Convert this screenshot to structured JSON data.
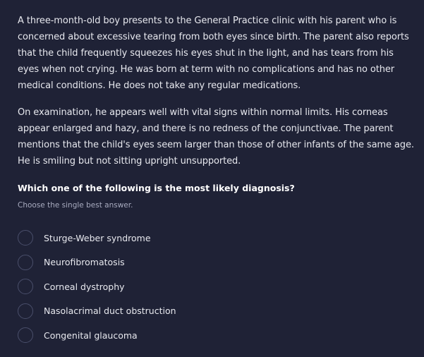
{
  "stem": {
    "paragraph_1": "A three-month-old boy presents to the General Practice clinic with his parent who is concerned about excessive tearing from both eyes since birth. The parent also reports that the child frequently squeezes his eyes shut in the light, and has tears from his eyes when not crying. He was born at term with no complications and has no other medical conditions. He does not take any regular medications.",
    "paragraph_2": "On examination, he appears well with vital signs within normal limits. His corneas appear enlarged and hazy, and there is no redness of the conjunctivae. The parent mentions that the child's eyes seem larger than those of other infants of the same age. He is smiling but not sitting upright unsupported."
  },
  "question": "Which one of the following is the most likely diagnosis?",
  "instruction": "Choose the single best answer.",
  "options": [
    {
      "label": "Sturge-Weber syndrome",
      "selected": false
    },
    {
      "label": "Neurofibromatosis",
      "selected": false
    },
    {
      "label": "Corneal dystrophy",
      "selected": false
    },
    {
      "label": "Nasolacrimal duct obstruction",
      "selected": false
    },
    {
      "label": "Congenital glaucoma",
      "selected": false
    }
  ],
  "colors": {
    "background": "#1f2236",
    "text": "#e7e8ee",
    "muted_text": "#a8abbf",
    "radio_border": "#4a4f6b"
  }
}
